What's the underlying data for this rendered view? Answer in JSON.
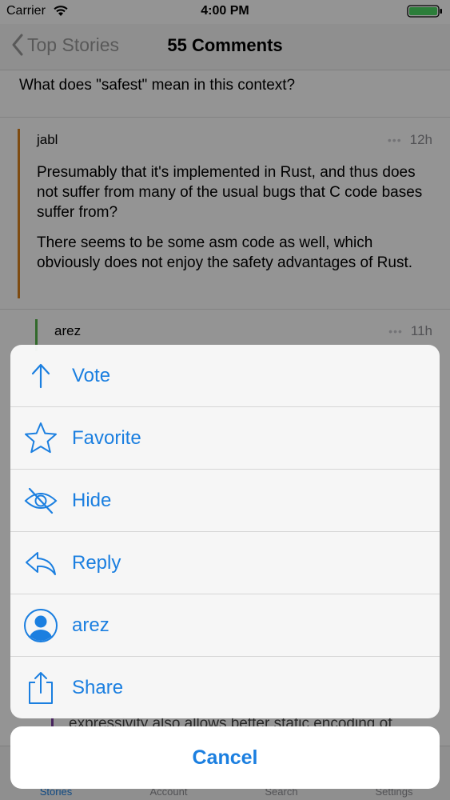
{
  "status_bar": {
    "carrier": "Carrier",
    "time": "4:00 PM"
  },
  "nav": {
    "back_label": "Top Stories",
    "title": "55 Comments"
  },
  "question": "What does \"safest\" mean in this context?",
  "comments": [
    {
      "author": "jabl",
      "time": "12h",
      "paragraphs": [
        "Presumably that it's implemented in Rust, and thus does not suffer from many of the usual bugs that C code bases suffer from?",
        "There seems to be some asm code as well, which obviously does not enjoy the safety advantages of Rust."
      ]
    },
    {
      "author": "arez",
      "time": "11h"
    }
  ],
  "partial_comment_text": "expressivity also allows better static encoding of",
  "action_sheet": {
    "actions": [
      {
        "label": "Vote",
        "icon": "arrow-up-icon"
      },
      {
        "label": "Favorite",
        "icon": "star-icon"
      },
      {
        "label": "Hide",
        "icon": "eye-slash-icon"
      },
      {
        "label": "Reply",
        "icon": "reply-icon"
      },
      {
        "label": "arez",
        "icon": "user-circle-icon"
      },
      {
        "label": "Share",
        "icon": "share-icon"
      }
    ],
    "cancel_label": "Cancel"
  },
  "tabs": [
    {
      "label": "Stories",
      "active": true
    },
    {
      "label": "Account",
      "active": false
    },
    {
      "label": "Search",
      "active": false
    },
    {
      "label": "Settings",
      "active": false
    }
  ],
  "colors": {
    "accent": "#1b7fe0",
    "thread_orange": "#d9821e",
    "thread_green": "#56b64a"
  }
}
